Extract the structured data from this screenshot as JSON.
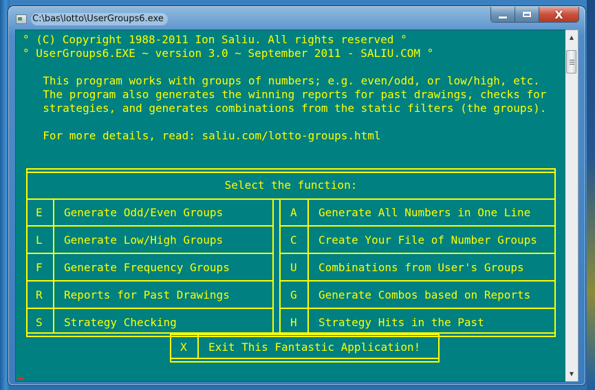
{
  "window": {
    "title": "C:\\bas\\lotto\\UserGroups6.exe",
    "icon": "console-app-icon",
    "controls": {
      "minimize": "minimize-icon",
      "maximize": "maximize-icon",
      "close_label": "X"
    }
  },
  "console": {
    "header_lines": [
      "° (C) Copyright 1988-2011 Ion Saliu. All rights reserved °",
      "° UserGroups6.EXE ~ version 3.0 ~ September 2011 - SALIU.COM °"
    ],
    "description_lines": [
      "  This program works with groups of numbers; e.g. even/odd, or low/high, etc.",
      "  The program also generates the winning reports for past drawings, checks for",
      "  strategies, and generates combinations from the static filters (the groups)."
    ],
    "details_line": "  For more details, read: saliu.com/lotto-groups.html"
  },
  "menu": {
    "title": "Select the function:",
    "left": [
      {
        "key": "E",
        "label": "Generate Odd/Even Groups"
      },
      {
        "key": "L",
        "label": "Generate Low/High Groups"
      },
      {
        "key": "F",
        "label": "Generate Frequency Groups"
      },
      {
        "key": "R",
        "label": "Reports for Past Drawings"
      },
      {
        "key": "S",
        "label": "Strategy Checking"
      }
    ],
    "right": [
      {
        "key": "A",
        "label": "Generate All Numbers in One Line"
      },
      {
        "key": "C",
        "label": "Create Your File of Number Groups"
      },
      {
        "key": "U",
        "label": "Combinations from User's Groups"
      },
      {
        "key": "G",
        "label": "Generate Combos based on Reports"
      },
      {
        "key": "H",
        "label": "Strategy Hits in the Past"
      }
    ],
    "exit": {
      "key": "X",
      "label": "Exit This Fantastic Application!"
    }
  },
  "colors": {
    "console_bg": "#008080",
    "console_fg": "#ffff00",
    "close_button": "#c9503c"
  }
}
